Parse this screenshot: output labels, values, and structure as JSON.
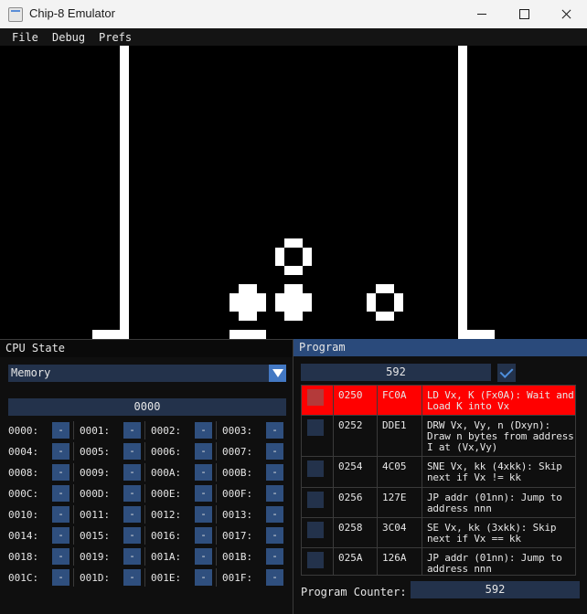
{
  "window": {
    "title": "Chip-8 Emulator"
  },
  "menu": {
    "items": [
      "File",
      "Debug",
      "Prefs"
    ]
  },
  "cpu_state": {
    "title": "CPU State",
    "view_selector": "Memory",
    "address_input": "0000",
    "memory": [
      {
        "addr": "0000:",
        "val": "-"
      },
      {
        "addr": "0001:",
        "val": "-"
      },
      {
        "addr": "0002:",
        "val": "-"
      },
      {
        "addr": "0003:",
        "val": "-"
      },
      {
        "addr": "0004:",
        "val": "-"
      },
      {
        "addr": "0005:",
        "val": "-"
      },
      {
        "addr": "0006:",
        "val": "-"
      },
      {
        "addr": "0007:",
        "val": "-"
      },
      {
        "addr": "0008:",
        "val": "-"
      },
      {
        "addr": "0009:",
        "val": "-"
      },
      {
        "addr": "000A:",
        "val": "-"
      },
      {
        "addr": "000B:",
        "val": "-"
      },
      {
        "addr": "000C:",
        "val": "-"
      },
      {
        "addr": "000D:",
        "val": "-"
      },
      {
        "addr": "000E:",
        "val": "-"
      },
      {
        "addr": "000F:",
        "val": "-"
      },
      {
        "addr": "0010:",
        "val": "-"
      },
      {
        "addr": "0011:",
        "val": "-"
      },
      {
        "addr": "0012:",
        "val": "-"
      },
      {
        "addr": "0013:",
        "val": "-"
      },
      {
        "addr": "0014:",
        "val": "-"
      },
      {
        "addr": "0015:",
        "val": "-"
      },
      {
        "addr": "0016:",
        "val": "-"
      },
      {
        "addr": "0017:",
        "val": "-"
      },
      {
        "addr": "0018:",
        "val": "-"
      },
      {
        "addr": "0019:",
        "val": "-"
      },
      {
        "addr": "001A:",
        "val": "-"
      },
      {
        "addr": "001B:",
        "val": "-"
      },
      {
        "addr": "001C:",
        "val": "-"
      },
      {
        "addr": "001D:",
        "val": "-"
      },
      {
        "addr": "001E:",
        "val": "-"
      },
      {
        "addr": "001F:",
        "val": "-"
      }
    ]
  },
  "program": {
    "title": "Program",
    "goto_value": "592",
    "rows": [
      {
        "addr": "0250",
        "opcode": "FC0A",
        "desc": "LD Vx, K (Fx0A): Wait and Load K into Vx",
        "active": true
      },
      {
        "addr": "0252",
        "opcode": "DDE1",
        "desc": "DRW Vx, Vy, n (Dxyn): Draw n bytes from address I at (Vx,Vy)",
        "active": false
      },
      {
        "addr": "0254",
        "opcode": "4C05",
        "desc": "SNE Vx, kk (4xkk): Skip next if Vx != kk",
        "active": false
      },
      {
        "addr": "0256",
        "opcode": "127E",
        "desc": "JP addr (01nn): Jump to address nnn",
        "active": false
      },
      {
        "addr": "0258",
        "opcode": "3C04",
        "desc": "SE Vx, kk (3xkk): Skip next if Vx == kk",
        "active": false
      },
      {
        "addr": "025A",
        "opcode": "126A",
        "desc": "JP addr (01nn): Jump to address nnn",
        "active": false
      }
    ],
    "pc_label": "Program Counter:",
    "pc_value": "592"
  },
  "colors": {
    "active_row": "#ff0000",
    "header_blue": "#2a4a7b",
    "button_blue": "#2f4f7e",
    "field_blue": "#23324b"
  }
}
